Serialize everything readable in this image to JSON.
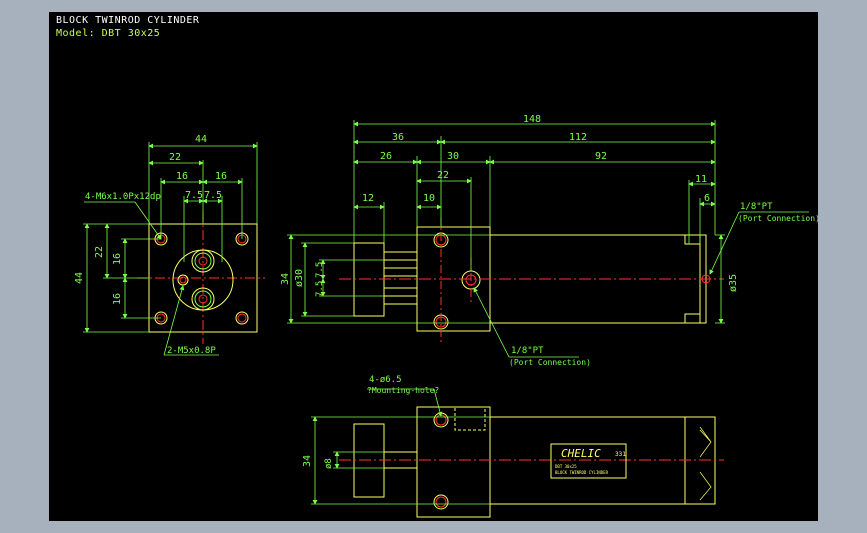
{
  "header": {
    "title": "BLOCK TWINROD CYLINDER",
    "model": "Model: DBT 30x25"
  },
  "front_view": {
    "dims": {
      "w44": "44",
      "w22": "22",
      "w16a": "16",
      "w16b": "16",
      "w7a": "7.5",
      "w7b": "7.5",
      "h44": "44",
      "h22": "22",
      "h16a": "16",
      "h16b": "16"
    },
    "callout_top": "4-M6x1.0Px12dp",
    "callout_bottom": "2-M5x0.8P"
  },
  "side_view": {
    "dims": {
      "d148": "148",
      "d36": "36",
      "d112": "112",
      "d26": "26",
      "d30": "30",
      "d92": "92",
      "d22": "22",
      "d12": "12",
      "d10": "10",
      "d11": "11",
      "d6": "6",
      "d34": "34",
      "phi30": "ø30",
      "d75a": "7.5",
      "d75b": "7.5",
      "phi35": "ø35"
    },
    "port_right": {
      "line1": "1/8\"PT",
      "line2": "(Port Connection)"
    },
    "port_bottom": {
      "line1": "1/8\"PT",
      "line2": "(Port Connection)"
    }
  },
  "bottom_view": {
    "dims": {
      "d34": "34",
      "phi8": "ø8"
    },
    "mounting": {
      "line1": "4-ø6.5",
      "line2": "?Mounting-hole?"
    },
    "brand": "CHELIC",
    "brand_small": "331",
    "label_lines": [
      "DBT 30x25",
      "BLOCK TWINROD CYLINDER"
    ]
  },
  "colors": {
    "background": "#000000",
    "frame": "#a7b0bd",
    "outline": "#ffff66",
    "dimension": "#7cff4a",
    "center": "#ff3030",
    "text_white": "#ffffff"
  }
}
